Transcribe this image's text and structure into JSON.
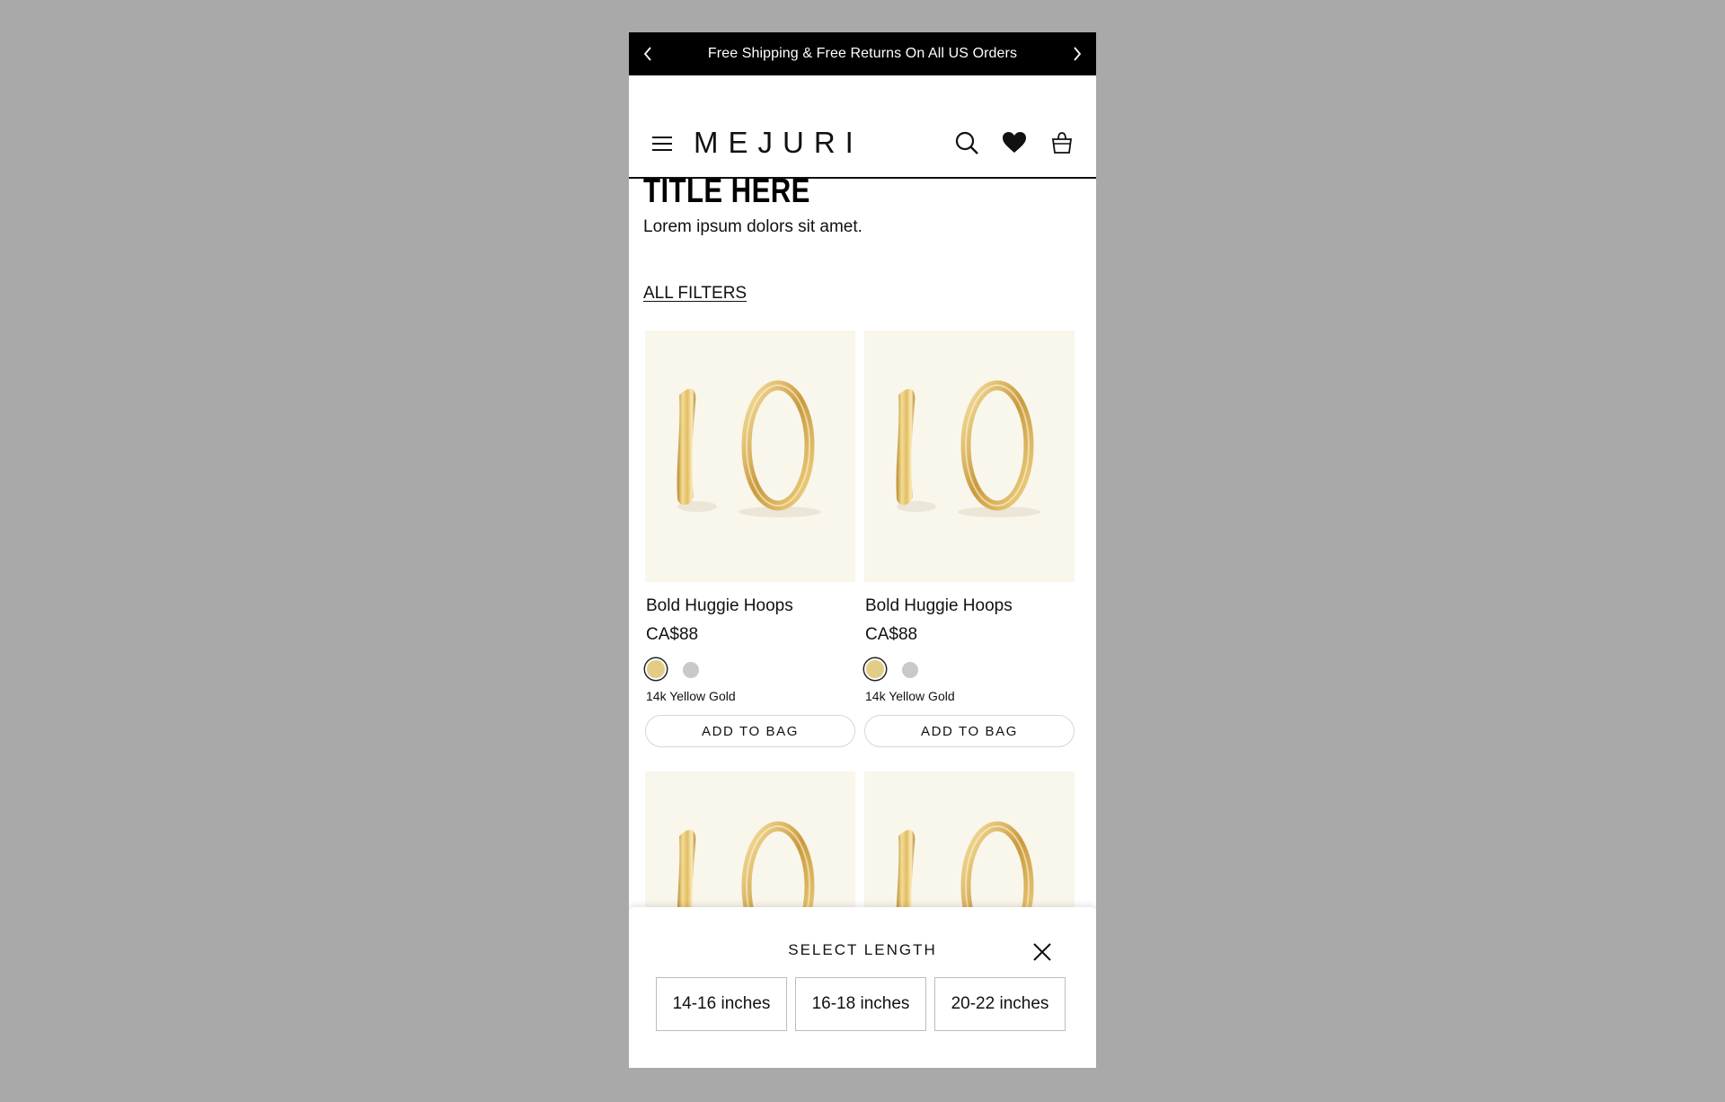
{
  "announcement": {
    "text": "Free Shipping & Free Returns On All US Orders",
    "prev_icon": "chevron-left-icon",
    "next_icon": "chevron-right-icon"
  },
  "header": {
    "logo": "MEJURI",
    "icons": [
      "menu-icon",
      "search-icon",
      "heart-icon",
      "shopping-bag-icon"
    ]
  },
  "page": {
    "title": "TITLE HERE",
    "subtitle": "Lorem ipsum dolors sit amet.",
    "filters_label": "ALL FILTERS"
  },
  "products": [
    {
      "name": "Bold Huggie Hoops",
      "price": "CA$88",
      "metal": "14k Yellow Gold",
      "cta": "ADD TO BAG",
      "swatches": [
        "#e3cd85",
        "#c9c9c9"
      ]
    },
    {
      "name": "Bold Huggie Hoops",
      "price": "CA$88",
      "metal": "14k Yellow Gold",
      "cta": "ADD TO BAG",
      "swatches": [
        "#e3cd85",
        "#c9c9c9"
      ]
    }
  ],
  "sheet": {
    "title": "SELECT LENGTH",
    "options": [
      "14-16 inches",
      "16-18 inches",
      "20-22 inches"
    ]
  },
  "colors": {
    "backdrop": "#a9a9a9",
    "product_bg": "#f9f6ec",
    "gold": "#d8b85f"
  }
}
